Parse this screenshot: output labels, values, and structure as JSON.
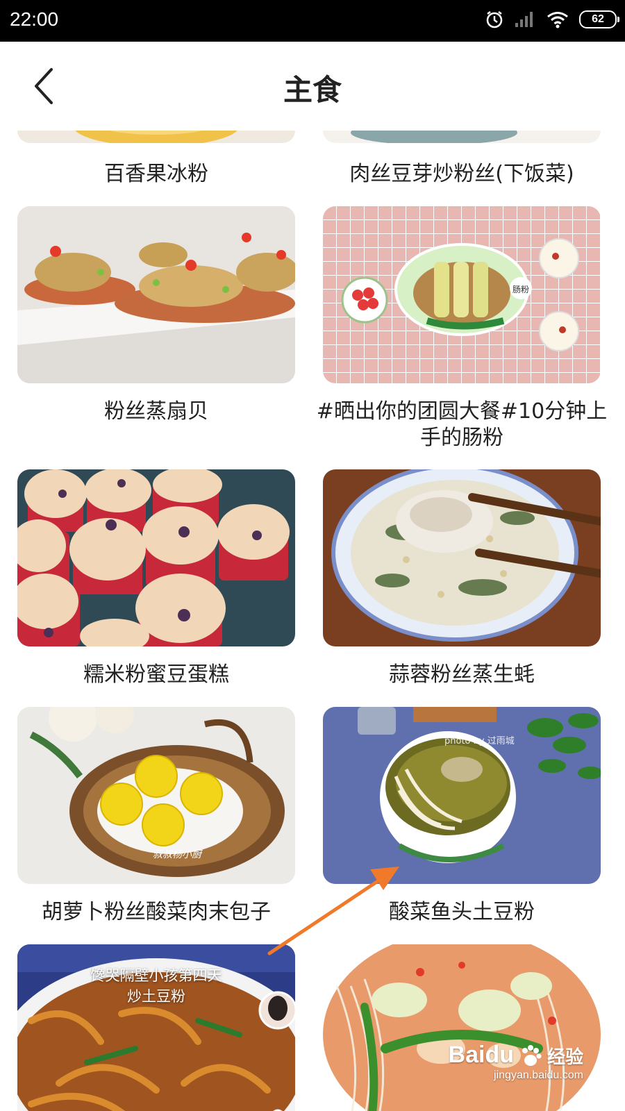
{
  "status_bar": {
    "time": "22:00",
    "battery": "62"
  },
  "header": {
    "title": "主食"
  },
  "recipes": [
    {
      "title": "百香果冰粉"
    },
    {
      "title": "肉丝豆芽炒粉丝(下饭菜)"
    },
    {
      "title": "粉丝蒸扇贝"
    },
    {
      "title": "#晒出你的团圆大餐#10分钟上手的肠粉"
    },
    {
      "title": "糯米粉蜜豆蛋糕"
    },
    {
      "title": "蒜蓉粉丝蒸生蚝"
    },
    {
      "title": "胡萝卜粉丝酸菜肉末包子"
    },
    {
      "title": "酸菜鱼头土豆粉"
    },
    {
      "title": "",
      "overlay": "馋哭隔壁小孩第四天\n炒土豆粉"
    },
    {
      "title": ""
    }
  ],
  "image_texts": {
    "photo_credit": "photo by 过雨城",
    "bun_watermark": "叔叔杨小厨",
    "sauce_label": "肠粉"
  },
  "watermark": {
    "brand": "Baidu",
    "sub": "经验",
    "url": "jingyan.baidu.com"
  },
  "colors": {
    "arrow": "#f07a2a",
    "status_bg": "#000000",
    "title": "#222222"
  }
}
